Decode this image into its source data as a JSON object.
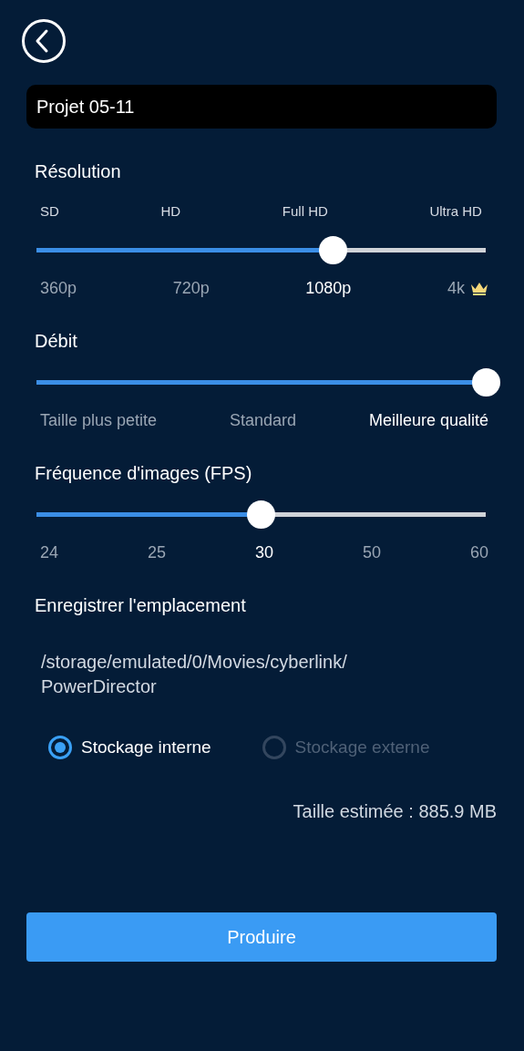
{
  "project_name": {
    "value": "Projet 05-11"
  },
  "sliders": [
    {
      "title": "Résolution",
      "top_labels": [
        "SD",
        "HD",
        "Full HD",
        "Ultra HD"
      ],
      "level": 0.66,
      "labels": [
        {
          "text": "360p",
          "selected": false,
          "premium": false
        },
        {
          "text": "720p",
          "selected": false,
          "premium": false
        },
        {
          "text": "1080p",
          "selected": true,
          "premium": false
        },
        {
          "text": "4k",
          "selected": false,
          "premium": true
        }
      ]
    },
    {
      "title": "Débit",
      "level": 1,
      "labels": [
        {
          "text": "Taille plus petite",
          "selected": false,
          "premium": false
        },
        {
          "text": "Standard",
          "selected": false,
          "premium": false
        },
        {
          "text": "Meilleure qualité",
          "selected": true,
          "premium": false
        }
      ]
    },
    {
      "title": "Fréquence d'images (FPS)",
      "level": 0.5,
      "labels": [
        {
          "text": "24",
          "selected": false,
          "premium": false
        },
        {
          "text": "25",
          "selected": false,
          "premium": false
        },
        {
          "text": "30",
          "selected": true,
          "premium": false
        },
        {
          "text": "50",
          "selected": false,
          "premium": false
        },
        {
          "text": "60",
          "selected": false,
          "premium": false
        }
      ]
    }
  ],
  "location": {
    "title": "Enregistrer l'emplacement",
    "path": "/storage/emulated/0/Movies/cyberlink/PowerDirector",
    "options": [
      {
        "label": "Stockage interne",
        "selected": true,
        "disabled": false
      },
      {
        "label": "Stockage externe",
        "selected": false,
        "disabled": true
      }
    ]
  },
  "estimate": "Taille estimée : 885.9 MB",
  "button": "Produire"
}
